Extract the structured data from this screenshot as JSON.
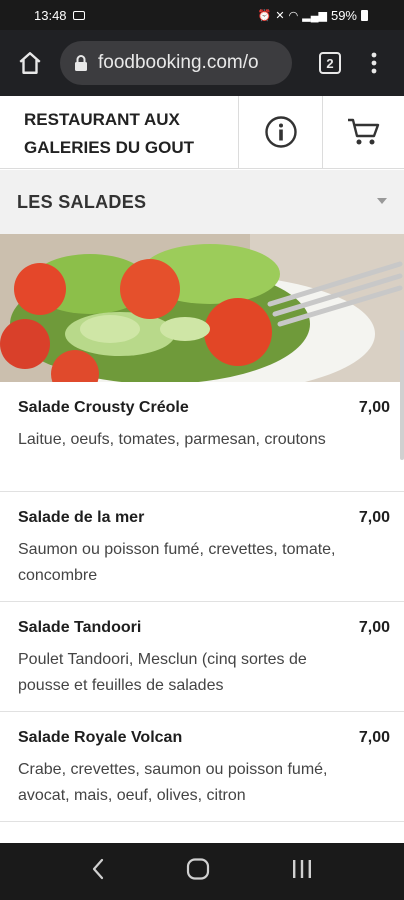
{
  "status_bar": {
    "time": "13:48",
    "battery": "59%"
  },
  "browser": {
    "url": "foodbooking.com/o",
    "tab_count": "2"
  },
  "restaurant": {
    "name_line1": "RESTAURANT AUX",
    "name_line2": "GALERIES DU GOUT"
  },
  "category": {
    "label": "LES SALADES"
  },
  "menu_items": [
    {
      "name": "Salade Crousty Créole",
      "price": "7,00",
      "description": "Laitue, oeufs, tomates, parmesan, croutons"
    },
    {
      "name": "Salade de la mer",
      "price": "7,00",
      "description": "Saumon ou poisson fumé, crevettes, tomate, concombre"
    },
    {
      "name": "Salade Tandoori",
      "price": "7,00",
      "description": "Poulet Tandoori, Mesclun (cinq sortes de pousse et feuilles de salades"
    },
    {
      "name": "Salade Royale Volcan",
      "price": "7,00",
      "description": "Crabe, crevettes, saumon ou poisson fumé, avocat, mais, oeuf, olives, citron"
    }
  ],
  "icons": {
    "home": "home-icon",
    "lock": "lock-icon",
    "info": "info-icon",
    "cart": "cart-icon",
    "back": "back-icon",
    "recents": "recents-icon"
  }
}
